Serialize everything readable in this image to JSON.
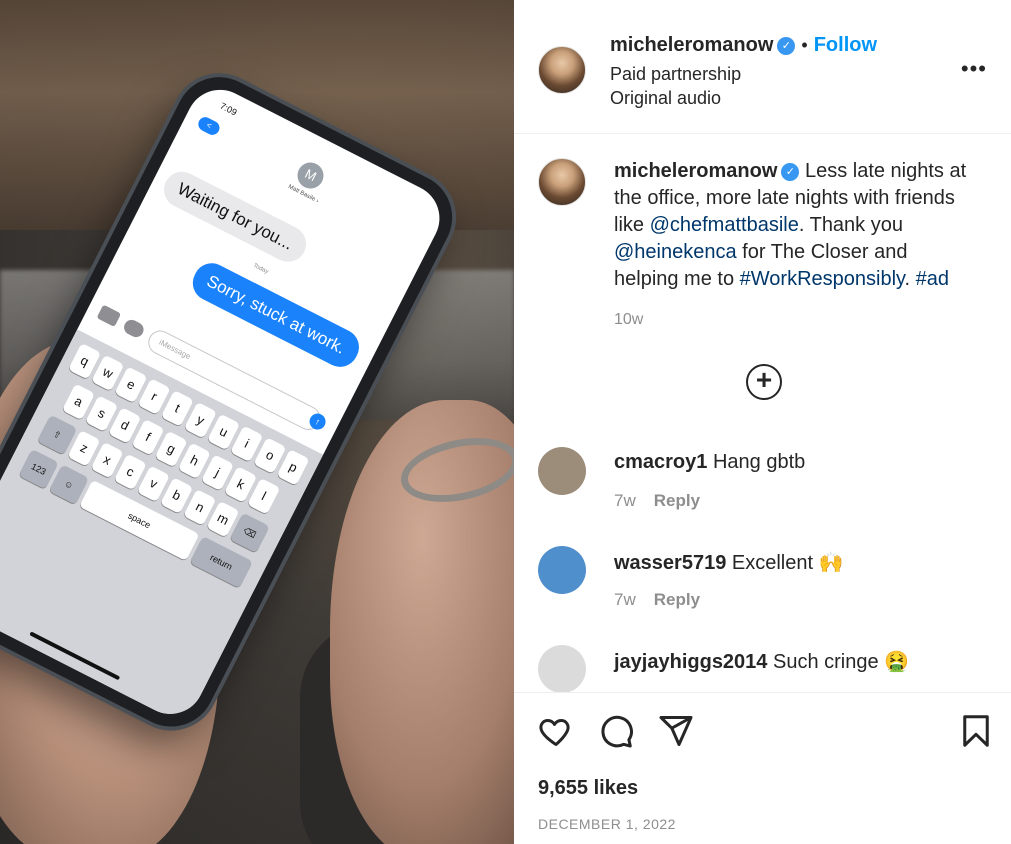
{
  "media": {
    "phone_time": "7:09",
    "back_badge": "<",
    "contact_initial": "M",
    "contact_name": "Matt Basile ›",
    "bubble_in": "Waiting for you...",
    "today_label": "Today",
    "bubble_out": "Sorry, stuck at work.",
    "message_placeholder": "iMessage",
    "keyboard_rows": [
      [
        "q",
        "w",
        "e",
        "r",
        "t",
        "y",
        "u",
        "i",
        "o",
        "p"
      ],
      [
        "a",
        "s",
        "d",
        "f",
        "g",
        "h",
        "j",
        "k",
        "l"
      ],
      [
        "⇧",
        "z",
        "x",
        "c",
        "v",
        "b",
        "n",
        "m",
        "⌫"
      ]
    ],
    "key_123": "123",
    "key_emoji": "☺",
    "key_space": "space",
    "key_return": "return",
    "send_arrow": "↑"
  },
  "header": {
    "username": "micheleromanow",
    "dot": "•",
    "follow_label": "Follow",
    "line2": "Paid partnership",
    "line3": "Original audio",
    "more_label": "•••",
    "verified_mark": "✓"
  },
  "caption": {
    "username": "micheleromanow",
    "text1": " Less late nights at the office, more late nights with friends like ",
    "mention1": "@chefmattbasile",
    "text2": ". Thank you ",
    "mention2": "@heinekenca",
    "text3": " for The Closer and helping me to ",
    "hashtag1": "#WorkResponsibly",
    "text4": ". ",
    "hashtag2": "#ad",
    "age": "10w"
  },
  "load_more_label": "+",
  "comments": [
    {
      "username": "cmacroy1",
      "text": " Hang gbtb",
      "age": "7w",
      "reply": "Reply",
      "avatar_color": "#9c8c7a"
    },
    {
      "username": "wasser5719",
      "text": " Excellent 🙌",
      "age": "7w",
      "reply": "Reply",
      "avatar_color": "#4f8fcc"
    },
    {
      "username": "jayjayhiggs2014",
      "text": " Such cringe 🤮",
      "age": "",
      "reply": "",
      "avatar_color": "#dbdbdb"
    }
  ],
  "likes": "9,655 likes",
  "date": "DECEMBER 1, 2022",
  "colors": {
    "link": "#00376b",
    "follow": "#0095f6",
    "muted": "#8e8e8e",
    "text": "#262626"
  }
}
